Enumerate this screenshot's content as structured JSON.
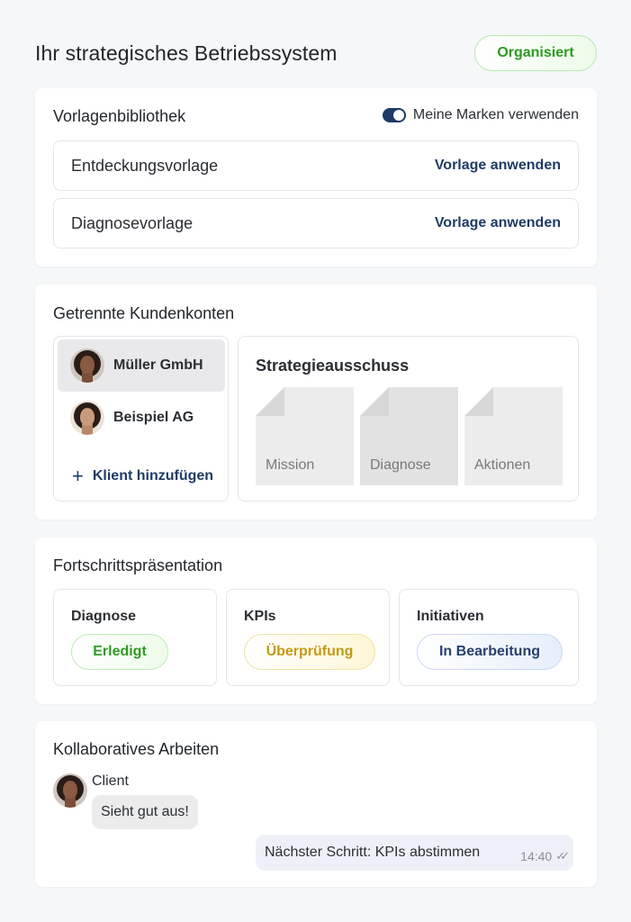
{
  "header": {
    "title": "Ihr strategisches Betriebssystem",
    "status": "Organisiert",
    "status_color": "#2e9b22"
  },
  "templates": {
    "title": "Vorlagenbibliothek",
    "toggle_label": "Meine Marken verwenden",
    "toggle_on": true,
    "items": [
      {
        "name": "Entdeckungsvorlage",
        "action": "Vorlage anwenden"
      },
      {
        "name": "Diagnosevorlage",
        "action": "Vorlage anwenden"
      }
    ]
  },
  "accounts": {
    "title": "Getrennte Kundenkonten",
    "clients": [
      {
        "name": "Müller GmbH",
        "selected": true
      },
      {
        "name": "Beispiel AG",
        "selected": false
      }
    ],
    "add_client": "Klient hinzufügen",
    "board": {
      "title": "Strategieausschuss",
      "docs": [
        "Mission",
        "Diagnose",
        "Aktionen"
      ]
    }
  },
  "progress": {
    "title": "Fortschrittspräsentation",
    "items": [
      {
        "label": "Diagnose",
        "status": "Erledigt",
        "color": "#2e9b22"
      },
      {
        "label": "KPIs",
        "status": "Überprüfung",
        "color": "#c39b13"
      },
      {
        "label": "Initiativen",
        "status": "In Bearbeitung",
        "color": "#27416d"
      }
    ]
  },
  "collab": {
    "title": "Kollaboratives Arbeiten",
    "incoming": {
      "sender": "Client",
      "text": "Sieht gut aus!"
    },
    "outgoing": {
      "text": "Nächster Schritt: KPIs abstimmen",
      "time": "14:40",
      "read_icon": "double-check-icon"
    }
  },
  "colors": {
    "accent": "#1f3b66",
    "background": "#f6f7f9"
  }
}
